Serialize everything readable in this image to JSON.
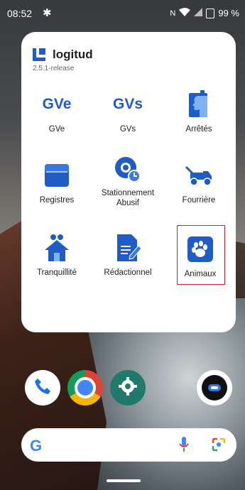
{
  "status_bar": {
    "time": "08:52",
    "battery": "99 %",
    "icons": [
      "settings-gear-icon",
      "nfc-icon",
      "wifi-icon",
      "signal-icon",
      "battery-icon"
    ]
  },
  "widget": {
    "brand": "logitud",
    "version": "2.5.1-release",
    "apps": [
      {
        "label": "GVe",
        "icon_text": "GVe",
        "icon": "gve-text-icon"
      },
      {
        "label": "GVs",
        "icon_text": "GVs",
        "icon": "gvs-text-icon"
      },
      {
        "label": "Arrêtés",
        "icon": "profile-document-icon"
      },
      {
        "label": "Registres",
        "icon": "ledger-icon"
      },
      {
        "label": "Stationnement Abusif",
        "icon": "wheel-clock-icon"
      },
      {
        "label": "Fourrière",
        "icon": "tow-truck-icon"
      },
      {
        "label": "Tranquillité",
        "icon": "house-binoculars-icon"
      },
      {
        "label": "Rédactionnel",
        "icon": "document-pen-icon"
      },
      {
        "label": "Animaux",
        "icon": "paw-icon"
      }
    ],
    "selected": "Animaux"
  },
  "colors": {
    "accent": "#1f5cc6",
    "highlight": "#d01f2a"
  },
  "dock": [
    "phone-icon",
    "chrome-icon",
    "settings-icon",
    "app-icon"
  ],
  "search_bar": {
    "icons": [
      "google-g-icon",
      "microphone-icon",
      "lens-icon"
    ]
  }
}
